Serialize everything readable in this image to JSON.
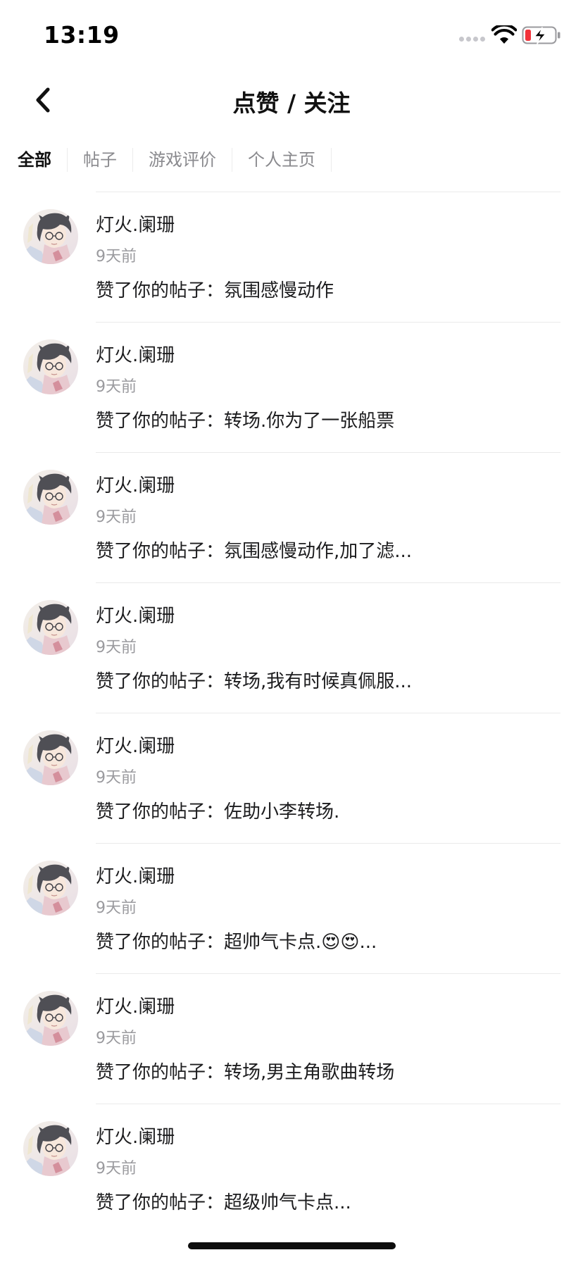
{
  "status_bar": {
    "time": "13:19"
  },
  "nav": {
    "back_icon": "chevron-left-icon",
    "title": "点赞 / 关注"
  },
  "tabs": [
    {
      "label": "全部",
      "active": true
    },
    {
      "label": "帖子",
      "active": false
    },
    {
      "label": "游戏评价",
      "active": false
    },
    {
      "label": "个人主页",
      "active": false
    }
  ],
  "notifications": [
    {
      "user": "灯火.阑珊",
      "time": "9天前",
      "action": "赞了你的帖子：",
      "content": "氛围感慢动作"
    },
    {
      "user": "灯火.阑珊",
      "time": "9天前",
      "action": "赞了你的帖子：",
      "content": "转场.你为了一张船票"
    },
    {
      "user": "灯火.阑珊",
      "time": "9天前",
      "action": "赞了你的帖子：",
      "content": "氛围感慢动作,加了滤..."
    },
    {
      "user": "灯火.阑珊",
      "time": "9天前",
      "action": "赞了你的帖子：",
      "content": "转场,我有时候真佩服..."
    },
    {
      "user": "灯火.阑珊",
      "time": "9天前",
      "action": "赞了你的帖子：",
      "content": "佐助小李转场."
    },
    {
      "user": "灯火.阑珊",
      "time": "9天前",
      "action": "赞了你的帖子：",
      "content": "超帅气卡点.😍😍..."
    },
    {
      "user": "灯火.阑珊",
      "time": "9天前",
      "action": "赞了你的帖子：",
      "content": "转场,男主角歌曲转场"
    },
    {
      "user": "灯火.阑珊",
      "time": "9天前",
      "action": "赞了你的帖子：",
      "content": "超级帅气卡点..."
    }
  ]
}
